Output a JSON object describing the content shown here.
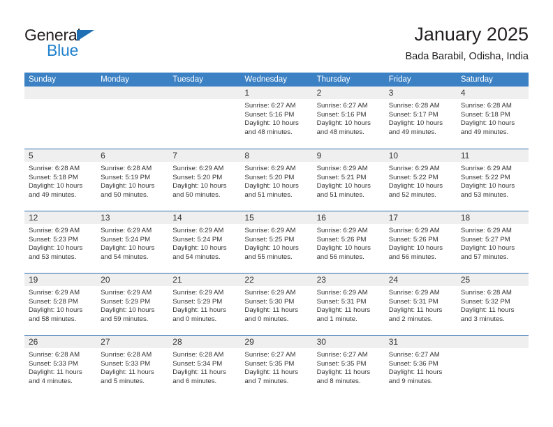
{
  "brand": {
    "name_part1": "General",
    "name_part2": "Blue",
    "accent_color": "#2081cd",
    "triangle_color": "#1f6fb5"
  },
  "header": {
    "title": "January 2025",
    "subtitle": "Bada Barabil, Odisha, India"
  },
  "theme": {
    "header_row_color": "#3b81c4",
    "week_divider_color": "#2f6fae",
    "date_band_color": "#efefef",
    "text_color": "#333333"
  },
  "calendar": {
    "weekday_headers": [
      "Sunday",
      "Monday",
      "Tuesday",
      "Wednesday",
      "Thursday",
      "Friday",
      "Saturday"
    ],
    "weeks": [
      [
        {
          "day": "",
          "empty": true
        },
        {
          "day": "",
          "empty": true
        },
        {
          "day": "",
          "empty": true
        },
        {
          "day": "1",
          "sunrise": "Sunrise: 6:27 AM",
          "sunset": "Sunset: 5:16 PM",
          "daylight": "Daylight: 10 hours and 48 minutes."
        },
        {
          "day": "2",
          "sunrise": "Sunrise: 6:27 AM",
          "sunset": "Sunset: 5:16 PM",
          "daylight": "Daylight: 10 hours and 48 minutes."
        },
        {
          "day": "3",
          "sunrise": "Sunrise: 6:28 AM",
          "sunset": "Sunset: 5:17 PM",
          "daylight": "Daylight: 10 hours and 49 minutes."
        },
        {
          "day": "4",
          "sunrise": "Sunrise: 6:28 AM",
          "sunset": "Sunset: 5:18 PM",
          "daylight": "Daylight: 10 hours and 49 minutes."
        }
      ],
      [
        {
          "day": "5",
          "sunrise": "Sunrise: 6:28 AM",
          "sunset": "Sunset: 5:18 PM",
          "daylight": "Daylight: 10 hours and 49 minutes."
        },
        {
          "day": "6",
          "sunrise": "Sunrise: 6:28 AM",
          "sunset": "Sunset: 5:19 PM",
          "daylight": "Daylight: 10 hours and 50 minutes."
        },
        {
          "day": "7",
          "sunrise": "Sunrise: 6:29 AM",
          "sunset": "Sunset: 5:20 PM",
          "daylight": "Daylight: 10 hours and 50 minutes."
        },
        {
          "day": "8",
          "sunrise": "Sunrise: 6:29 AM",
          "sunset": "Sunset: 5:20 PM",
          "daylight": "Daylight: 10 hours and 51 minutes."
        },
        {
          "day": "9",
          "sunrise": "Sunrise: 6:29 AM",
          "sunset": "Sunset: 5:21 PM",
          "daylight": "Daylight: 10 hours and 51 minutes."
        },
        {
          "day": "10",
          "sunrise": "Sunrise: 6:29 AM",
          "sunset": "Sunset: 5:22 PM",
          "daylight": "Daylight: 10 hours and 52 minutes."
        },
        {
          "day": "11",
          "sunrise": "Sunrise: 6:29 AM",
          "sunset": "Sunset: 5:22 PM",
          "daylight": "Daylight: 10 hours and 53 minutes."
        }
      ],
      [
        {
          "day": "12",
          "sunrise": "Sunrise: 6:29 AM",
          "sunset": "Sunset: 5:23 PM",
          "daylight": "Daylight: 10 hours and 53 minutes."
        },
        {
          "day": "13",
          "sunrise": "Sunrise: 6:29 AM",
          "sunset": "Sunset: 5:24 PM",
          "daylight": "Daylight: 10 hours and 54 minutes."
        },
        {
          "day": "14",
          "sunrise": "Sunrise: 6:29 AM",
          "sunset": "Sunset: 5:24 PM",
          "daylight": "Daylight: 10 hours and 54 minutes."
        },
        {
          "day": "15",
          "sunrise": "Sunrise: 6:29 AM",
          "sunset": "Sunset: 5:25 PM",
          "daylight": "Daylight: 10 hours and 55 minutes."
        },
        {
          "day": "16",
          "sunrise": "Sunrise: 6:29 AM",
          "sunset": "Sunset: 5:26 PM",
          "daylight": "Daylight: 10 hours and 56 minutes."
        },
        {
          "day": "17",
          "sunrise": "Sunrise: 6:29 AM",
          "sunset": "Sunset: 5:26 PM",
          "daylight": "Daylight: 10 hours and 56 minutes."
        },
        {
          "day": "18",
          "sunrise": "Sunrise: 6:29 AM",
          "sunset": "Sunset: 5:27 PM",
          "daylight": "Daylight: 10 hours and 57 minutes."
        }
      ],
      [
        {
          "day": "19",
          "sunrise": "Sunrise: 6:29 AM",
          "sunset": "Sunset: 5:28 PM",
          "daylight": "Daylight: 10 hours and 58 minutes."
        },
        {
          "day": "20",
          "sunrise": "Sunrise: 6:29 AM",
          "sunset": "Sunset: 5:29 PM",
          "daylight": "Daylight: 10 hours and 59 minutes."
        },
        {
          "day": "21",
          "sunrise": "Sunrise: 6:29 AM",
          "sunset": "Sunset: 5:29 PM",
          "daylight": "Daylight: 11 hours and 0 minutes."
        },
        {
          "day": "22",
          "sunrise": "Sunrise: 6:29 AM",
          "sunset": "Sunset: 5:30 PM",
          "daylight": "Daylight: 11 hours and 0 minutes."
        },
        {
          "day": "23",
          "sunrise": "Sunrise: 6:29 AM",
          "sunset": "Sunset: 5:31 PM",
          "daylight": "Daylight: 11 hours and 1 minute."
        },
        {
          "day": "24",
          "sunrise": "Sunrise: 6:29 AM",
          "sunset": "Sunset: 5:31 PM",
          "daylight": "Daylight: 11 hours and 2 minutes."
        },
        {
          "day": "25",
          "sunrise": "Sunrise: 6:28 AM",
          "sunset": "Sunset: 5:32 PM",
          "daylight": "Daylight: 11 hours and 3 minutes."
        }
      ],
      [
        {
          "day": "26",
          "sunrise": "Sunrise: 6:28 AM",
          "sunset": "Sunset: 5:33 PM",
          "daylight": "Daylight: 11 hours and 4 minutes."
        },
        {
          "day": "27",
          "sunrise": "Sunrise: 6:28 AM",
          "sunset": "Sunset: 5:33 PM",
          "daylight": "Daylight: 11 hours and 5 minutes."
        },
        {
          "day": "28",
          "sunrise": "Sunrise: 6:28 AM",
          "sunset": "Sunset: 5:34 PM",
          "daylight": "Daylight: 11 hours and 6 minutes."
        },
        {
          "day": "29",
          "sunrise": "Sunrise: 6:27 AM",
          "sunset": "Sunset: 5:35 PM",
          "daylight": "Daylight: 11 hours and 7 minutes."
        },
        {
          "day": "30",
          "sunrise": "Sunrise: 6:27 AM",
          "sunset": "Sunset: 5:35 PM",
          "daylight": "Daylight: 11 hours and 8 minutes."
        },
        {
          "day": "31",
          "sunrise": "Sunrise: 6:27 AM",
          "sunset": "Sunset: 5:36 PM",
          "daylight": "Daylight: 11 hours and 9 minutes."
        },
        {
          "day": "",
          "empty": true
        }
      ]
    ]
  }
}
